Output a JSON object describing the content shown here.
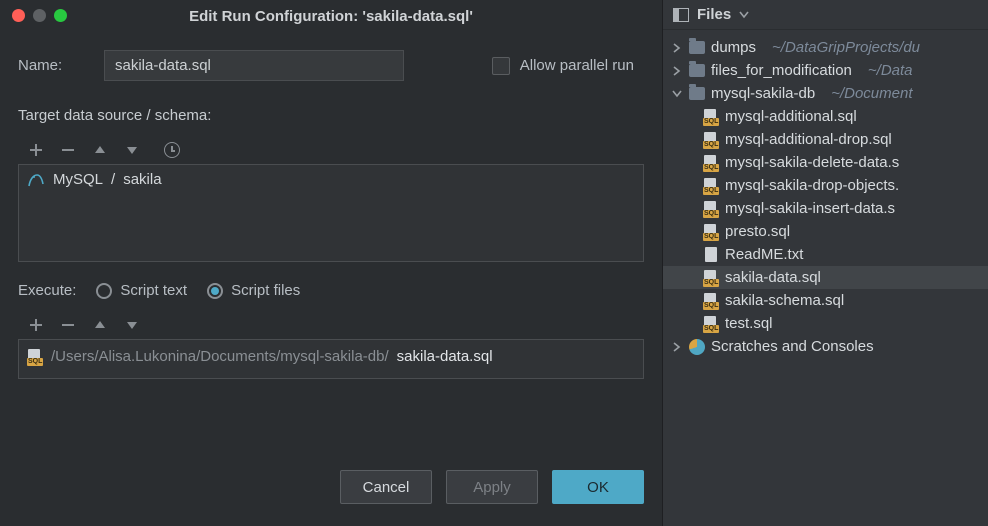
{
  "dialog": {
    "title": "Edit Run Configuration: 'sakila-data.sql'",
    "name_label": "Name:",
    "name_value": "sakila-data.sql",
    "allow_parallel_label": "Allow parallel run",
    "target_label": "Target data source / schema:",
    "ds_item": {
      "source": "MySQL",
      "sep": "/",
      "schema": "sakila"
    },
    "execute_label": "Execute:",
    "radio_script_text": "Script text",
    "radio_script_files": "Script files",
    "file_item": {
      "dir": "/Users/Alisa.Lukonina/Documents/mysql-sakila-db/",
      "fname": "sakila-data.sql"
    },
    "buttons": {
      "cancel": "Cancel",
      "apply": "Apply",
      "ok": "OK"
    },
    "sql_badge": "SQL"
  },
  "files_panel": {
    "title": "Files",
    "tree": {
      "dumps": {
        "label": "dumps",
        "path": "~/DataGripProjects/du"
      },
      "files_mod": {
        "label": "files_for_modification",
        "path": "~/Data"
      },
      "sakila_dir": {
        "label": "mysql-sakila-db",
        "path": "~/Document"
      },
      "children": [
        "mysql-additional.sql",
        "mysql-additional-drop.sql",
        "mysql-sakila-delete-data.s",
        "mysql-sakila-drop-objects.",
        "mysql-sakila-insert-data.s",
        "presto.sql",
        "ReadME.txt",
        "sakila-data.sql",
        "sakila-schema.sql",
        "test.sql"
      ],
      "scratches": "Scratches and Consoles"
    }
  }
}
